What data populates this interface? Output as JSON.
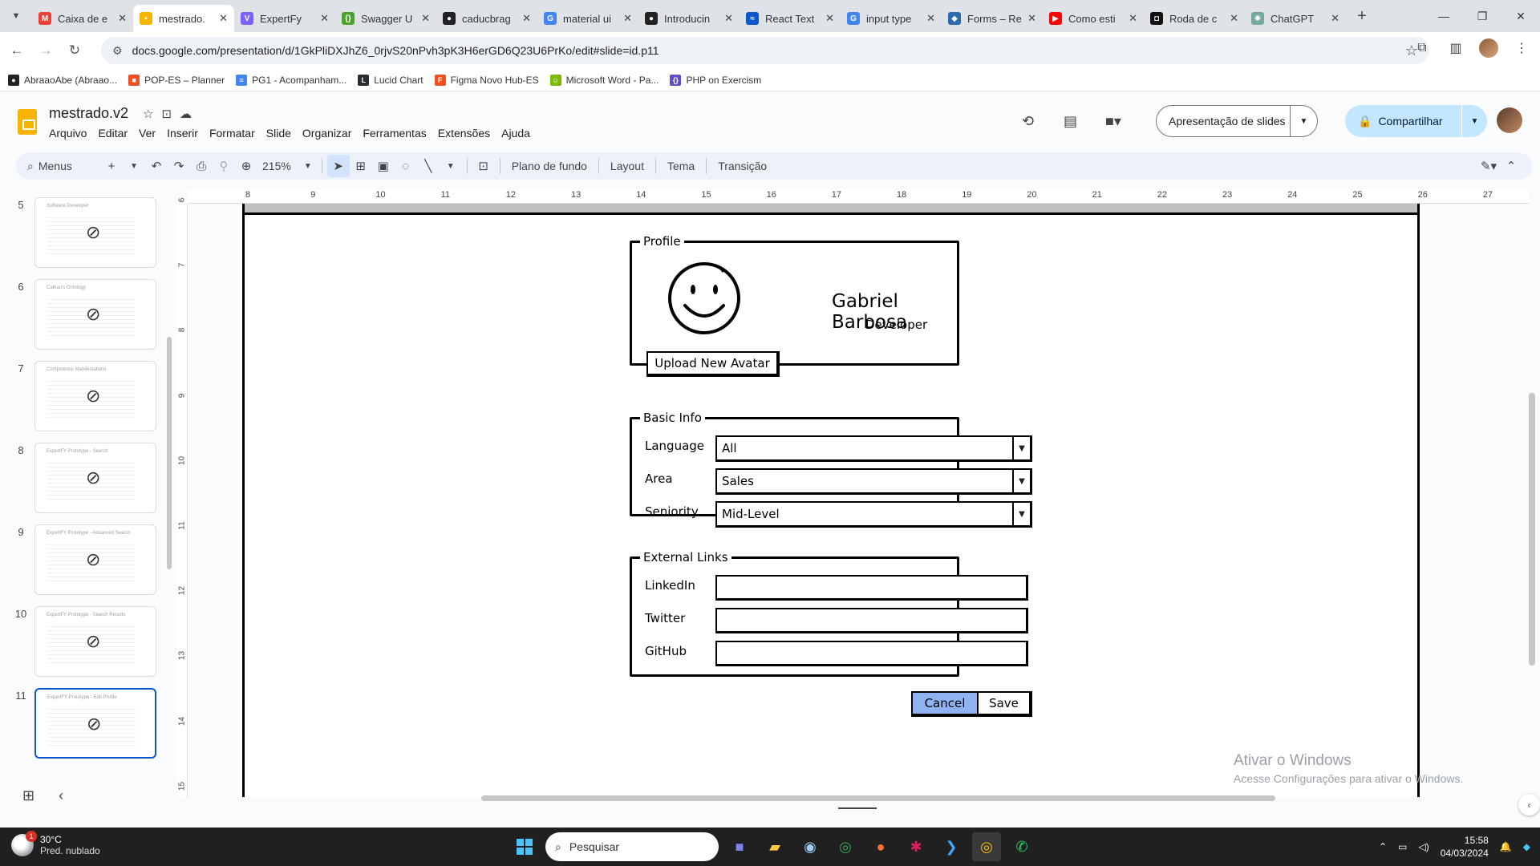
{
  "browser": {
    "tabs": [
      {
        "title": "Caixa de e",
        "fav": "M",
        "color": "#ea4335"
      },
      {
        "title": "mestrado.",
        "fav": "▪",
        "color": "#f6b400",
        "active": true
      },
      {
        "title": "ExpertFy",
        "fav": "V",
        "color": "#7b61ff"
      },
      {
        "title": "Swagger U",
        "fav": "{}",
        "color": "#49a32b"
      },
      {
        "title": "caducbrag",
        "fav": "●",
        "color": "#222222"
      },
      {
        "title": "material ui",
        "fav": "G",
        "color": "#4285f4"
      },
      {
        "title": "Introducin",
        "fav": "●",
        "color": "#222222"
      },
      {
        "title": "React Text",
        "fav": "≈",
        "color": "#0b57d0"
      },
      {
        "title": "input type",
        "fav": "G",
        "color": "#4285f4"
      },
      {
        "title": "Forms – Re",
        "fav": "◆",
        "color": "#2b6cb0"
      },
      {
        "title": "Como esti",
        "fav": "▶",
        "color": "#ff0000"
      },
      {
        "title": "Roda de c",
        "fav": "◘",
        "color": "#111111"
      },
      {
        "title": "ChatGPT",
        "fav": "✺",
        "color": "#74aa9c"
      }
    ],
    "url": "docs.google.com/presentation/d/1GkPliDXJhZ6_0rjvS20nPvh3pK3H6erGD6Q23U6PrKo/edit#slide=id.p11",
    "bookmarks": [
      {
        "label": "AbraaoAbe (Abraao...",
        "color": "#222222",
        "glyph": "●"
      },
      {
        "label": "POP-ES – Planner",
        "color": "#f25022",
        "glyph": "■"
      },
      {
        "label": "PG1 - Acompanham...",
        "color": "#4285f4",
        "glyph": "≡"
      },
      {
        "label": "Lucid Chart",
        "color": "#282c33",
        "glyph": "L"
      },
      {
        "label": "Figma Novo Hub-ES",
        "color": "#f24e1e",
        "glyph": "F"
      },
      {
        "label": "Microsoft Word - Pa...",
        "color": "#7cbb00",
        "glyph": "☺"
      },
      {
        "label": "PHP on Exercism",
        "color": "#604fcd",
        "glyph": "{}"
      }
    ]
  },
  "docs": {
    "title": "mestrado.v2",
    "menu": [
      "Arquivo",
      "Editar",
      "Ver",
      "Inserir",
      "Formatar",
      "Slide",
      "Organizar",
      "Ferramentas",
      "Extensões",
      "Ajuda"
    ],
    "present_label": "Apresentação de slides",
    "share_label": "Compartilhar",
    "toolbar": {
      "menus_label": "Menus",
      "zoom": "215%",
      "background": "Plano de fundo",
      "layout": "Layout",
      "theme": "Tema",
      "transition": "Transição"
    }
  },
  "filmstrip": [
    {
      "num": "5",
      "title": "Software Developer"
    },
    {
      "num": "6",
      "title": "Calhau's Ontology"
    },
    {
      "num": "7",
      "title": "Competence Manifestations"
    },
    {
      "num": "8",
      "title": "ExpertFY Prototype - Search"
    },
    {
      "num": "9",
      "title": "ExpertFY Prototype - Advanced Search"
    },
    {
      "num": "10",
      "title": "ExpertFY Prototype - Search Results"
    },
    {
      "num": "11",
      "title": "ExpertFY Prototype - Edit Profile",
      "active": true
    }
  ],
  "ruler": {
    "h": [
      "8",
      "9",
      "10",
      "11",
      "12",
      "13",
      "14",
      "15",
      "16",
      "17",
      "18",
      "19",
      "20",
      "21",
      "22",
      "23",
      "24",
      "25",
      "26",
      "27"
    ],
    "v": [
      "6",
      "7",
      "8",
      "9",
      "10",
      "11",
      "12",
      "13",
      "14",
      "15"
    ]
  },
  "wireframe": {
    "profile_legend": "Profile",
    "user_name": "Gabriel Barbosa",
    "user_role": "Developer",
    "upload_label": "Upload New Avatar",
    "basic_legend": "Basic Info",
    "language_label": "Language",
    "language_value": "All",
    "area_label": "Area",
    "area_value": "Sales",
    "seniority_label": "Seniority",
    "seniority_value": "Mid-Level",
    "links_legend": "External Links",
    "linkedin_label": "LinkedIn",
    "twitter_label": "Twitter",
    "github_label": "GitHub",
    "cancel_label": "Cancel",
    "save_label": "Save",
    "accent": "#8fb3f0"
  },
  "watermark": {
    "line1": "Ativar o Windows",
    "line2": "Acesse Configurações para ativar o Windows."
  },
  "taskbar": {
    "temp": "30°C",
    "weather": "Pred. nublado",
    "badge": "1",
    "search_placeholder": "Pesquisar",
    "time": "15:58",
    "date": "04/03/2024"
  }
}
